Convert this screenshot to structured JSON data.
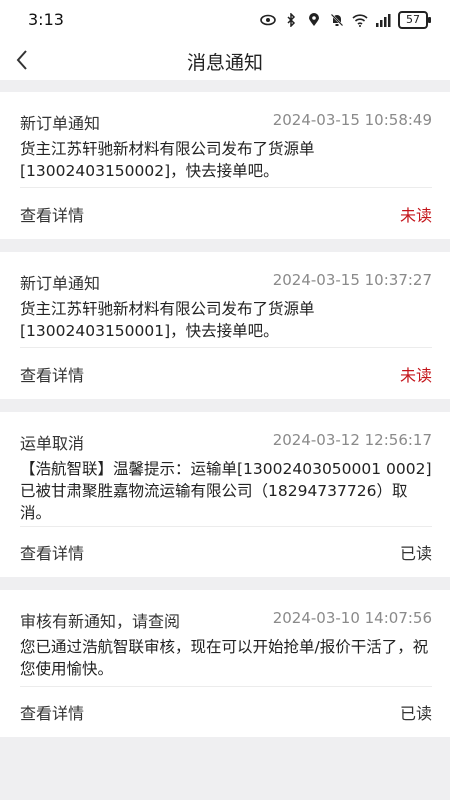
{
  "status_bar": {
    "time": "3:13",
    "battery": "57"
  },
  "header": {
    "title": "消息通知"
  },
  "messages": [
    {
      "title": "新订单通知",
      "time": "2024-03-15 10:58:49",
      "body": "货主江苏轩驰新材料有限公司发布了货源单[13002403150002]，快去接单吧。",
      "detail_label": "查看详情",
      "status": "未读"
    },
    {
      "title": "新订单通知",
      "time": "2024-03-15 10:37:27",
      "body": "货主江苏轩驰新材料有限公司发布了货源单[13002403150001]，快去接单吧。",
      "detail_label": "查看详情",
      "status": "未读"
    },
    {
      "title": "运单取消",
      "time": "2024-03-12 12:56:17",
      "body": "【浩航智联】温馨提示：运输单[13002403050001 0002]已被甘肃聚胜嘉物流运输有限公司（18294737726）取消。",
      "detail_label": "查看详情",
      "status": "已读"
    },
    {
      "title": "审核有新通知，请查阅",
      "time": "2024-03-10 14:07:56",
      "body": "您已通过浩航智联审核，现在可以开始抢单/报价干活了，祝您使用愉快。",
      "detail_label": "查看详情",
      "status": "已读"
    }
  ],
  "colors": {
    "unread": "#c4161c",
    "read": "#333333",
    "background": "#efeff1"
  }
}
